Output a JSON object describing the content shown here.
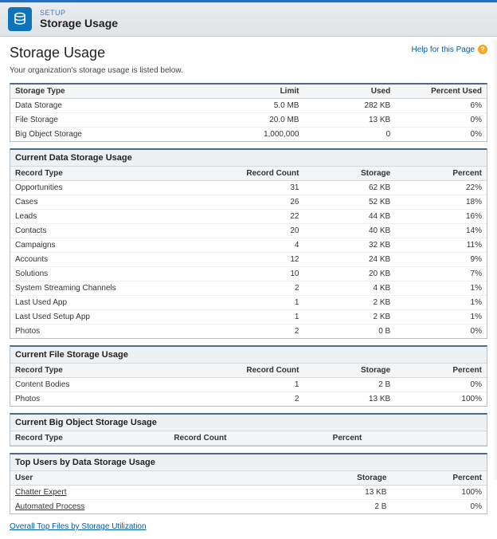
{
  "topbar": {
    "setup": "SETUP",
    "title": "Storage Usage"
  },
  "page": {
    "title": "Storage Usage",
    "help": "Help for this Page",
    "subtext": "Your organization's storage usage is listed below."
  },
  "summary": {
    "headers": {
      "type": "Storage Type",
      "limit": "Limit",
      "used": "Used",
      "pct": "Percent Used"
    },
    "rows": [
      {
        "type": "Data Storage",
        "limit": "5.0 MB",
        "used": "282 KB",
        "pct": "6%"
      },
      {
        "type": "File Storage",
        "limit": "20.0 MB",
        "used": "13 KB",
        "pct": "0%"
      },
      {
        "type": "Big Object Storage",
        "limit": "1,000,000",
        "used": "0",
        "pct": "0%"
      }
    ]
  },
  "dataUsage": {
    "title": "Current Data Storage Usage",
    "headers": {
      "type": "Record Type",
      "count": "Record Count",
      "storage": "Storage",
      "pct": "Percent"
    },
    "rows": [
      {
        "type": "Opportunities",
        "count": "31",
        "storage": "62 KB",
        "pct": "22%"
      },
      {
        "type": "Cases",
        "count": "26",
        "storage": "52 KB",
        "pct": "18%"
      },
      {
        "type": "Leads",
        "count": "22",
        "storage": "44 KB",
        "pct": "16%"
      },
      {
        "type": "Contacts",
        "count": "20",
        "storage": "40 KB",
        "pct": "14%"
      },
      {
        "type": "Campaigns",
        "count": "4",
        "storage": "32 KB",
        "pct": "11%"
      },
      {
        "type": "Accounts",
        "count": "12",
        "storage": "24 KB",
        "pct": "9%"
      },
      {
        "type": "Solutions",
        "count": "10",
        "storage": "20 KB",
        "pct": "7%"
      },
      {
        "type": "System Streaming Channels",
        "count": "2",
        "storage": "4 KB",
        "pct": "1%"
      },
      {
        "type": "Last Used App",
        "count": "1",
        "storage": "2 KB",
        "pct": "1%"
      },
      {
        "type": "Last Used Setup App",
        "count": "1",
        "storage": "2 KB",
        "pct": "1%"
      },
      {
        "type": "Photos",
        "count": "2",
        "storage": "0 B",
        "pct": "0%"
      }
    ]
  },
  "fileUsage": {
    "title": "Current File Storage Usage",
    "headers": {
      "type": "Record Type",
      "count": "Record Count",
      "storage": "Storage",
      "pct": "Percent"
    },
    "rows": [
      {
        "type": "Content Bodies",
        "count": "1",
        "storage": "2 B",
        "pct": "0%"
      },
      {
        "type": "Photos",
        "count": "2",
        "storage": "13 KB",
        "pct": "100%"
      }
    ]
  },
  "bigObject": {
    "title": "Current Big Object Storage Usage",
    "headers": {
      "type": "Record Type",
      "count": "Record Count",
      "pct": "Percent"
    }
  },
  "topUsers": {
    "title": "Top Users by Data Storage Usage",
    "headers": {
      "user": "User",
      "storage": "Storage",
      "pct": "Percent"
    },
    "rows": [
      {
        "user": "Chatter Expert",
        "storage": "13 KB",
        "pct": "100%"
      },
      {
        "user": "Automated Process",
        "storage": "2 B",
        "pct": "0%"
      }
    ]
  },
  "bottomLink": "Overall Top Files by Storage Utilization"
}
